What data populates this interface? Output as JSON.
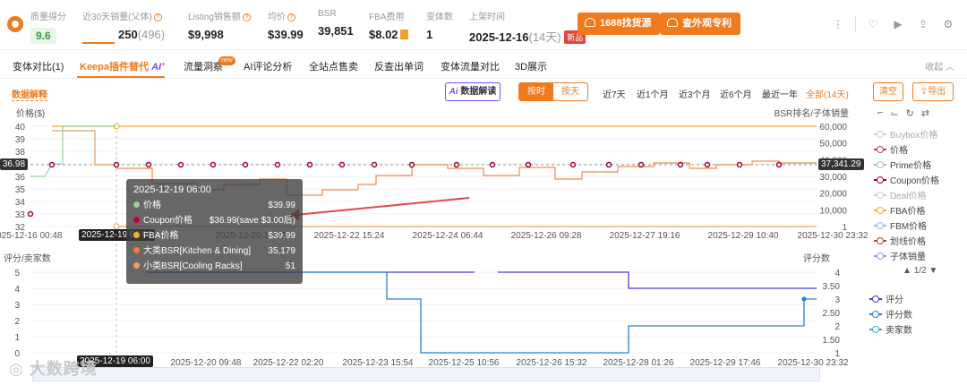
{
  "header": {
    "quality_label": "质量得分",
    "quality_value": "9.6",
    "sales_label": "近30天销量(父体)",
    "sales_value": "250",
    "sales_parent": "(496)",
    "listing_sales_label": "Listing销售额",
    "listing_sales_value": "$9,998",
    "price_label": "均价",
    "price_value": "$39.99",
    "bsr_label": "BSR",
    "bsr_value": "39,851",
    "fba_label": "FBA费用",
    "fba_value": "$8.02",
    "variants_label": "变体数",
    "variants_value": "1",
    "launch_label": "上架时间",
    "launch_value": "2025-12-16",
    "launch_days": "(14天)",
    "new_badge": "新品",
    "btn_1688": "1688找货源",
    "btn_patent": "查外观专利"
  },
  "tabs": [
    {
      "label": "变体对比(1)"
    },
    {
      "label": "Keepa插件替代"
    },
    {
      "label": "流量洞察"
    },
    {
      "label": "AI评论分析"
    },
    {
      "label": "全站点售卖"
    },
    {
      "label": "反查出单词"
    },
    {
      "label": "变体流量对比"
    },
    {
      "label": "3D展示"
    }
  ],
  "tab_ai": "AI",
  "tab_hot_badge": "new",
  "collapse_label": "收起",
  "toolbar": {
    "data_explain": "数据解释",
    "ai_button": "数据解读",
    "by_time": "按时",
    "by_day": "按天",
    "ranges": [
      "近7天",
      "近1个月",
      "近3个月",
      "近6个月",
      "最近一年",
      "全部(14天)"
    ],
    "clear": "清空",
    "export": "导出"
  },
  "legend": {
    "items": [
      "Buybox价格",
      "价格",
      "Prime价格",
      "Coupon价格",
      "Deal价格",
      "FBA价格",
      "FBM价格",
      "划线价格",
      "子体销量"
    ],
    "colors": [
      "#cccccc",
      "#b04a4a",
      "#9ccc9c",
      "#a0003a",
      "#cccccc",
      "#f0b030",
      "#9ab8e0",
      "#a0522d",
      "#8aa0d0"
    ],
    "dim": [
      true,
      false,
      false,
      false,
      true,
      false,
      false,
      false,
      false
    ],
    "pager": "1/2",
    "items2": [
      "评分",
      "评分数",
      "卖家数"
    ],
    "colors2": [
      "#4b3bd6",
      "#2a7fd0",
      "#3ab0c0"
    ]
  },
  "top_chart": {
    "left_title": "价格($)",
    "right_title": "BSR排名/子体销量",
    "left_ticks": [
      "40",
      "39",
      "38",
      "37",
      "36",
      "35",
      "34",
      "33",
      "32"
    ],
    "right_ticks": [
      "60,000",
      "50,000",
      "40,000",
      "30,000",
      "20,000",
      "10,000",
      "1"
    ],
    "x_ticks": [
      "2025-12-16 00:48",
      "2025-12-19 06:00",
      "2025-12-20 17:32",
      "2025-12-22 15:24",
      "2025-12-24 06:44",
      "2025-12-26 09:28",
      "2025-12-27 19:16",
      "2025-12-29 10:40",
      "2025-12-30 23:32"
    ],
    "crosshair_left": "36.98",
    "crosshair_right": "37,341.29"
  },
  "bottom_chart": {
    "left_title": "评分/卖家数",
    "right_title": "评分数",
    "left_ticks": [
      "5",
      "4",
      "3",
      "2",
      "1",
      "0"
    ],
    "right_ticks": [
      "4",
      "3.50",
      "3",
      "2.50",
      "2",
      "1.50",
      "1"
    ],
    "x_ticks": [
      "2025-12-19 06:00",
      "2025-12-20 09:48",
      "2025-12-22 02:20",
      "2025-12-23 15:54",
      "2025-12-25 10:56",
      "2025-12-26 15:32",
      "2025-12-28 01:26",
      "2025-12-29 17:46",
      "2025-12-30 23:32"
    ]
  },
  "tooltip": {
    "time": "2025-12-19 06:00",
    "rows": [
      {
        "name": "价格",
        "value": "$39.99",
        "color": "#9ccc9c"
      },
      {
        "name": "Coupon价格",
        "value": "$36.99(save $3.00后)",
        "color": "#c0003a"
      },
      {
        "name": "FBA价格",
        "value": "$39.99",
        "color": "#f0b030"
      },
      {
        "name": "大类BSR[Kitchen & Dining]",
        "value": "35,179",
        "color": "#f07a3a"
      },
      {
        "name": "小类BSR[Cooling Racks]",
        "value": "51",
        "color": "#f0a060"
      }
    ]
  },
  "watermark": "大数跨境"
}
